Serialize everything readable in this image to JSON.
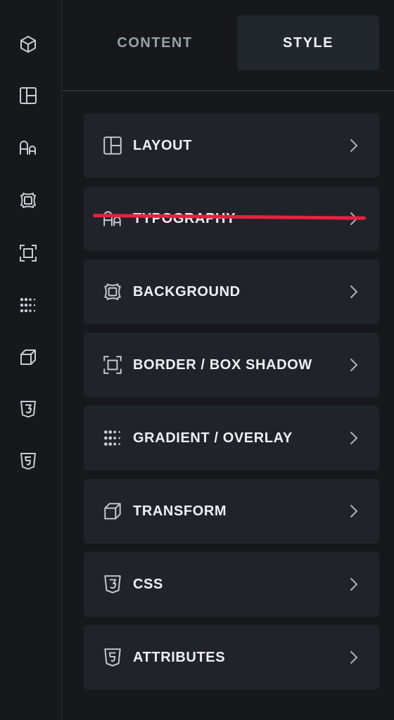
{
  "tabs": {
    "content_label": "CONTENT",
    "style_label": "STYLE"
  },
  "rail": {
    "items": [
      {
        "icon": "cube-icon"
      },
      {
        "icon": "layout-icon"
      },
      {
        "icon": "typography-icon"
      },
      {
        "icon": "background-icon"
      },
      {
        "icon": "border-icon"
      },
      {
        "icon": "gradient-icon"
      },
      {
        "icon": "transform-icon"
      },
      {
        "icon": "css3-icon"
      },
      {
        "icon": "html5-icon"
      }
    ]
  },
  "sections": [
    {
      "label": "LAYOUT",
      "icon": "layout-icon"
    },
    {
      "label": "TYPOGRAPHY",
      "icon": "typography-icon",
      "struck_through": true
    },
    {
      "label": "BACKGROUND",
      "icon": "background-icon"
    },
    {
      "label": "BORDER / BOX SHADOW",
      "icon": "border-icon"
    },
    {
      "label": "GRADIENT / OVERLAY",
      "icon": "gradient-icon"
    },
    {
      "label": "TRANSFORM",
      "icon": "transform-icon"
    },
    {
      "label": "CSS",
      "icon": "css3-icon"
    },
    {
      "label": "ATTRIBUTES",
      "icon": "html5-icon"
    }
  ],
  "colors": {
    "background": "#16181c",
    "card": "#20242a",
    "active_tab": "#22262d",
    "strike": "#e8213f"
  }
}
